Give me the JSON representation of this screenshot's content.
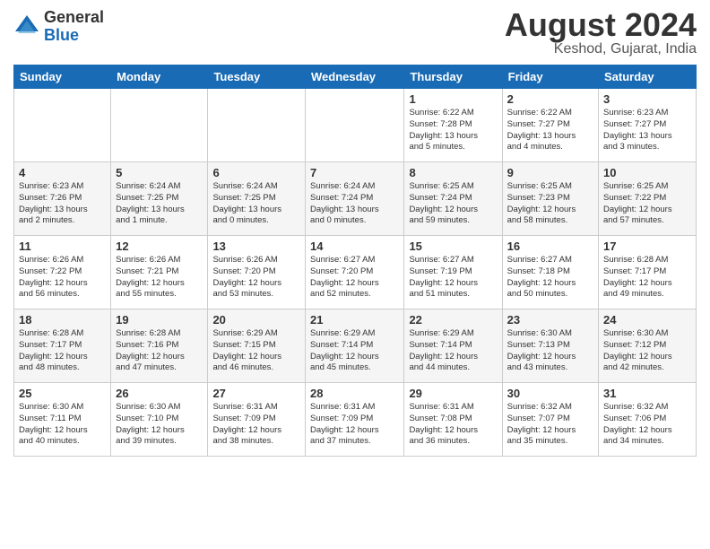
{
  "logo": {
    "general": "General",
    "blue": "Blue"
  },
  "header": {
    "month_year": "August 2024",
    "location": "Keshod, Gujarat, India"
  },
  "days_of_week": [
    "Sunday",
    "Monday",
    "Tuesday",
    "Wednesday",
    "Thursday",
    "Friday",
    "Saturday"
  ],
  "weeks": [
    [
      {
        "day": "",
        "info": ""
      },
      {
        "day": "",
        "info": ""
      },
      {
        "day": "",
        "info": ""
      },
      {
        "day": "",
        "info": ""
      },
      {
        "day": "1",
        "info": "Sunrise: 6:22 AM\nSunset: 7:28 PM\nDaylight: 13 hours\nand 5 minutes."
      },
      {
        "day": "2",
        "info": "Sunrise: 6:22 AM\nSunset: 7:27 PM\nDaylight: 13 hours\nand 4 minutes."
      },
      {
        "day": "3",
        "info": "Sunrise: 6:23 AM\nSunset: 7:27 PM\nDaylight: 13 hours\nand 3 minutes."
      }
    ],
    [
      {
        "day": "4",
        "info": "Sunrise: 6:23 AM\nSunset: 7:26 PM\nDaylight: 13 hours\nand 2 minutes."
      },
      {
        "day": "5",
        "info": "Sunrise: 6:24 AM\nSunset: 7:25 PM\nDaylight: 13 hours\nand 1 minute."
      },
      {
        "day": "6",
        "info": "Sunrise: 6:24 AM\nSunset: 7:25 PM\nDaylight: 13 hours\nand 0 minutes."
      },
      {
        "day": "7",
        "info": "Sunrise: 6:24 AM\nSunset: 7:24 PM\nDaylight: 13 hours\nand 0 minutes."
      },
      {
        "day": "8",
        "info": "Sunrise: 6:25 AM\nSunset: 7:24 PM\nDaylight: 12 hours\nand 59 minutes."
      },
      {
        "day": "9",
        "info": "Sunrise: 6:25 AM\nSunset: 7:23 PM\nDaylight: 12 hours\nand 58 minutes."
      },
      {
        "day": "10",
        "info": "Sunrise: 6:25 AM\nSunset: 7:22 PM\nDaylight: 12 hours\nand 57 minutes."
      }
    ],
    [
      {
        "day": "11",
        "info": "Sunrise: 6:26 AM\nSunset: 7:22 PM\nDaylight: 12 hours\nand 56 minutes."
      },
      {
        "day": "12",
        "info": "Sunrise: 6:26 AM\nSunset: 7:21 PM\nDaylight: 12 hours\nand 55 minutes."
      },
      {
        "day": "13",
        "info": "Sunrise: 6:26 AM\nSunset: 7:20 PM\nDaylight: 12 hours\nand 53 minutes."
      },
      {
        "day": "14",
        "info": "Sunrise: 6:27 AM\nSunset: 7:20 PM\nDaylight: 12 hours\nand 52 minutes."
      },
      {
        "day": "15",
        "info": "Sunrise: 6:27 AM\nSunset: 7:19 PM\nDaylight: 12 hours\nand 51 minutes."
      },
      {
        "day": "16",
        "info": "Sunrise: 6:27 AM\nSunset: 7:18 PM\nDaylight: 12 hours\nand 50 minutes."
      },
      {
        "day": "17",
        "info": "Sunrise: 6:28 AM\nSunset: 7:17 PM\nDaylight: 12 hours\nand 49 minutes."
      }
    ],
    [
      {
        "day": "18",
        "info": "Sunrise: 6:28 AM\nSunset: 7:17 PM\nDaylight: 12 hours\nand 48 minutes."
      },
      {
        "day": "19",
        "info": "Sunrise: 6:28 AM\nSunset: 7:16 PM\nDaylight: 12 hours\nand 47 minutes."
      },
      {
        "day": "20",
        "info": "Sunrise: 6:29 AM\nSunset: 7:15 PM\nDaylight: 12 hours\nand 46 minutes."
      },
      {
        "day": "21",
        "info": "Sunrise: 6:29 AM\nSunset: 7:14 PM\nDaylight: 12 hours\nand 45 minutes."
      },
      {
        "day": "22",
        "info": "Sunrise: 6:29 AM\nSunset: 7:14 PM\nDaylight: 12 hours\nand 44 minutes."
      },
      {
        "day": "23",
        "info": "Sunrise: 6:30 AM\nSunset: 7:13 PM\nDaylight: 12 hours\nand 43 minutes."
      },
      {
        "day": "24",
        "info": "Sunrise: 6:30 AM\nSunset: 7:12 PM\nDaylight: 12 hours\nand 42 minutes."
      }
    ],
    [
      {
        "day": "25",
        "info": "Sunrise: 6:30 AM\nSunset: 7:11 PM\nDaylight: 12 hours\nand 40 minutes."
      },
      {
        "day": "26",
        "info": "Sunrise: 6:30 AM\nSunset: 7:10 PM\nDaylight: 12 hours\nand 39 minutes."
      },
      {
        "day": "27",
        "info": "Sunrise: 6:31 AM\nSunset: 7:09 PM\nDaylight: 12 hours\nand 38 minutes."
      },
      {
        "day": "28",
        "info": "Sunrise: 6:31 AM\nSunset: 7:09 PM\nDaylight: 12 hours\nand 37 minutes."
      },
      {
        "day": "29",
        "info": "Sunrise: 6:31 AM\nSunset: 7:08 PM\nDaylight: 12 hours\nand 36 minutes."
      },
      {
        "day": "30",
        "info": "Sunrise: 6:32 AM\nSunset: 7:07 PM\nDaylight: 12 hours\nand 35 minutes."
      },
      {
        "day": "31",
        "info": "Sunrise: 6:32 AM\nSunset: 7:06 PM\nDaylight: 12 hours\nand 34 minutes."
      }
    ]
  ]
}
